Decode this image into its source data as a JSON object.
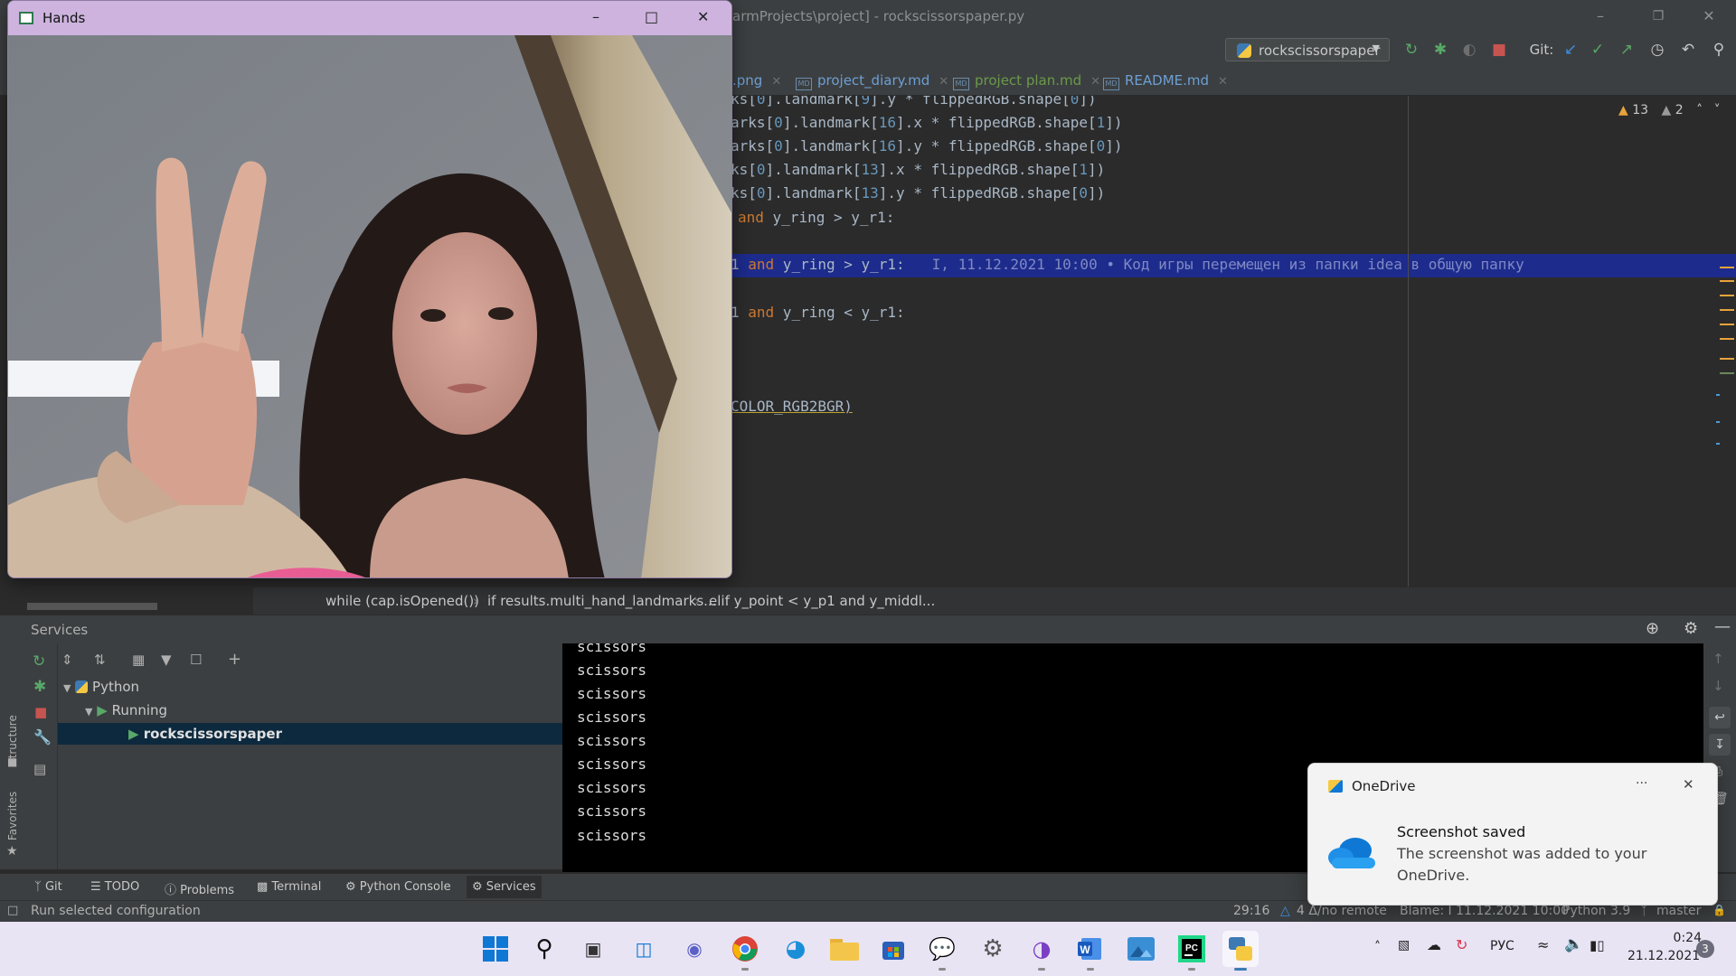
{
  "ide": {
    "title": "armProjects\\project] - rockscissorspaper.py",
    "run_config": "rockscissorspaper",
    "git_label": "Git:"
  },
  "tabs": [
    {
      "label": ".png"
    },
    {
      "label": "project_diary.md"
    },
    {
      "label": "project plan.md"
    },
    {
      "label": "README.md"
    }
  ],
  "editor": {
    "lines": [
      {
        "a": "ks[",
        "n1": "0",
        "b": "].landmark[",
        "n2": "9",
        "c": "].y * flippedRGB.shape[",
        "n3": "0",
        "d": "])"
      },
      {
        "a": "arks[",
        "n1": "0",
        "b": "].landmark[",
        "n2": "16",
        "c": "].x * flippedRGB.shape[",
        "n3": "1",
        "d": "])"
      },
      {
        "a": "arks[",
        "n1": "0",
        "b": "].landmark[",
        "n2": "16",
        "c": "].y * flippedRGB.shape[",
        "n3": "0",
        "d": "])"
      },
      {
        "a": "ks[",
        "n1": "0",
        "b": "].landmark[",
        "n2": "13",
        "c": "].x * flippedRGB.shape[",
        "n3": "1",
        "d": "])"
      },
      {
        "a": "ks[",
        "n1": "0",
        "b": "].landmark[",
        "n2": "13",
        "c": "].y * flippedRGB.shape[",
        "n3": "0",
        "d": "])"
      }
    ],
    "cond1": {
      "kw": "and",
      "rest": " y_ring > y_r1:"
    },
    "cond2": {
      "pre": "1 ",
      "kw": "and",
      "rest": " y_ring > y_r1:"
    },
    "blame": "I, 11.12.2021 10:00 • Код игры перемещен из папки idea в общую папку",
    "cond3": {
      "pre": "1 ",
      "kw": "and",
      "rest": " y_ring < y_r1:"
    },
    "tail": "COLOR_RGB2BGR)",
    "warnings": "13",
    "weak_warnings": "2"
  },
  "breadcrumb": [
    "while (cap.isOpened())",
    "if results.multi_hand_landmarks...",
    "elif y_point < y_p1 and y_middl..."
  ],
  "services": {
    "title": "Services",
    "tree": {
      "root": "Python",
      "group": "Running",
      "item": "rockscissorspaper"
    },
    "rail_labels": {
      "structure": "Structure",
      "favorites": "Favorites"
    },
    "console_lines": [
      "scissors",
      "scissors",
      "scissors",
      "scissors",
      "scissors",
      "scissors",
      "scissors",
      "scissors",
      "scissors"
    ]
  },
  "toolwindows": [
    {
      "label": "Git",
      "icon": "git-branch-icon"
    },
    {
      "label": "TODO",
      "icon": "list-icon"
    },
    {
      "label": "Problems",
      "icon": "info-icon"
    },
    {
      "label": "Terminal",
      "icon": "terminal-icon"
    },
    {
      "label": "Python Console",
      "icon": "python-icon"
    },
    {
      "label": "Services",
      "icon": "services-icon"
    }
  ],
  "status": {
    "message": "Run selected configuration",
    "position": "29:16",
    "vcs": "4 Δ/no remote",
    "blame": "Blame: I 11.12.2021 10:00",
    "interpreter": "Python 3.9",
    "branch": "master"
  },
  "hands_window": {
    "title": "Hands"
  },
  "toast": {
    "app": "OneDrive",
    "more": "···",
    "heading": "Screenshot saved",
    "body_line1": "The screenshot was added to your",
    "body_line2": "OneDrive."
  },
  "taskbar": {
    "language": "РУС",
    "time": "0:24",
    "date": "21.12.2021",
    "badge": "3"
  },
  "colors": {
    "accent": "#1d2b8c",
    "ide_bg": "#2b2b2b",
    "taskbar_bg": "#e8e4f4"
  }
}
